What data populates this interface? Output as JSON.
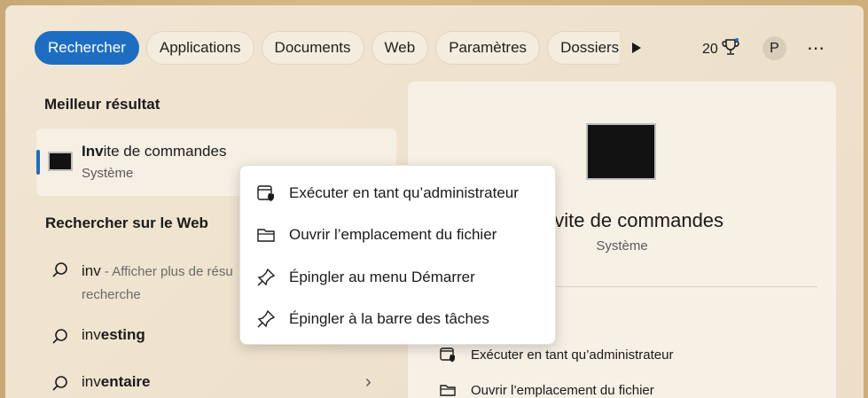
{
  "filters": [
    {
      "label": "Rechercher",
      "active": true
    },
    {
      "label": "Applications",
      "active": false
    },
    {
      "label": "Documents",
      "active": false
    },
    {
      "label": "Web",
      "active": false
    },
    {
      "label": "Paramètres",
      "active": false
    },
    {
      "label": "Dossiers",
      "active": false
    }
  ],
  "header": {
    "score": "20",
    "avatar_initial": "P"
  },
  "best_match": {
    "heading": "Meilleur résultat",
    "title_bold": "Inv",
    "title_rest": "ite de commandes",
    "subtitle": "Système"
  },
  "web": {
    "heading": "Rechercher sur le Web",
    "items": [
      {
        "term": "inv",
        "detail": " - Afficher plus de résu",
        "detail2": "recherche"
      },
      {
        "bold": "inv",
        "rest": "esting"
      },
      {
        "bold": "inv",
        "rest": "entaire"
      }
    ]
  },
  "preview": {
    "title": "Invite de commandes",
    "subtitle": "Système",
    "actions": [
      {
        "label": "Exécuter en tant qu’administrateur"
      },
      {
        "label": "Ouvrir l’emplacement du fichier"
      }
    ]
  },
  "context_menu": {
    "items": [
      {
        "label": "Exécuter en tant qu’administrateur"
      },
      {
        "label": "Ouvrir l’emplacement du fichier"
      },
      {
        "label": "Épingler au menu Démarrer"
      },
      {
        "label": "Épingler à la barre des tâches"
      }
    ]
  },
  "colors": {
    "accent": "#1d6ec3"
  }
}
